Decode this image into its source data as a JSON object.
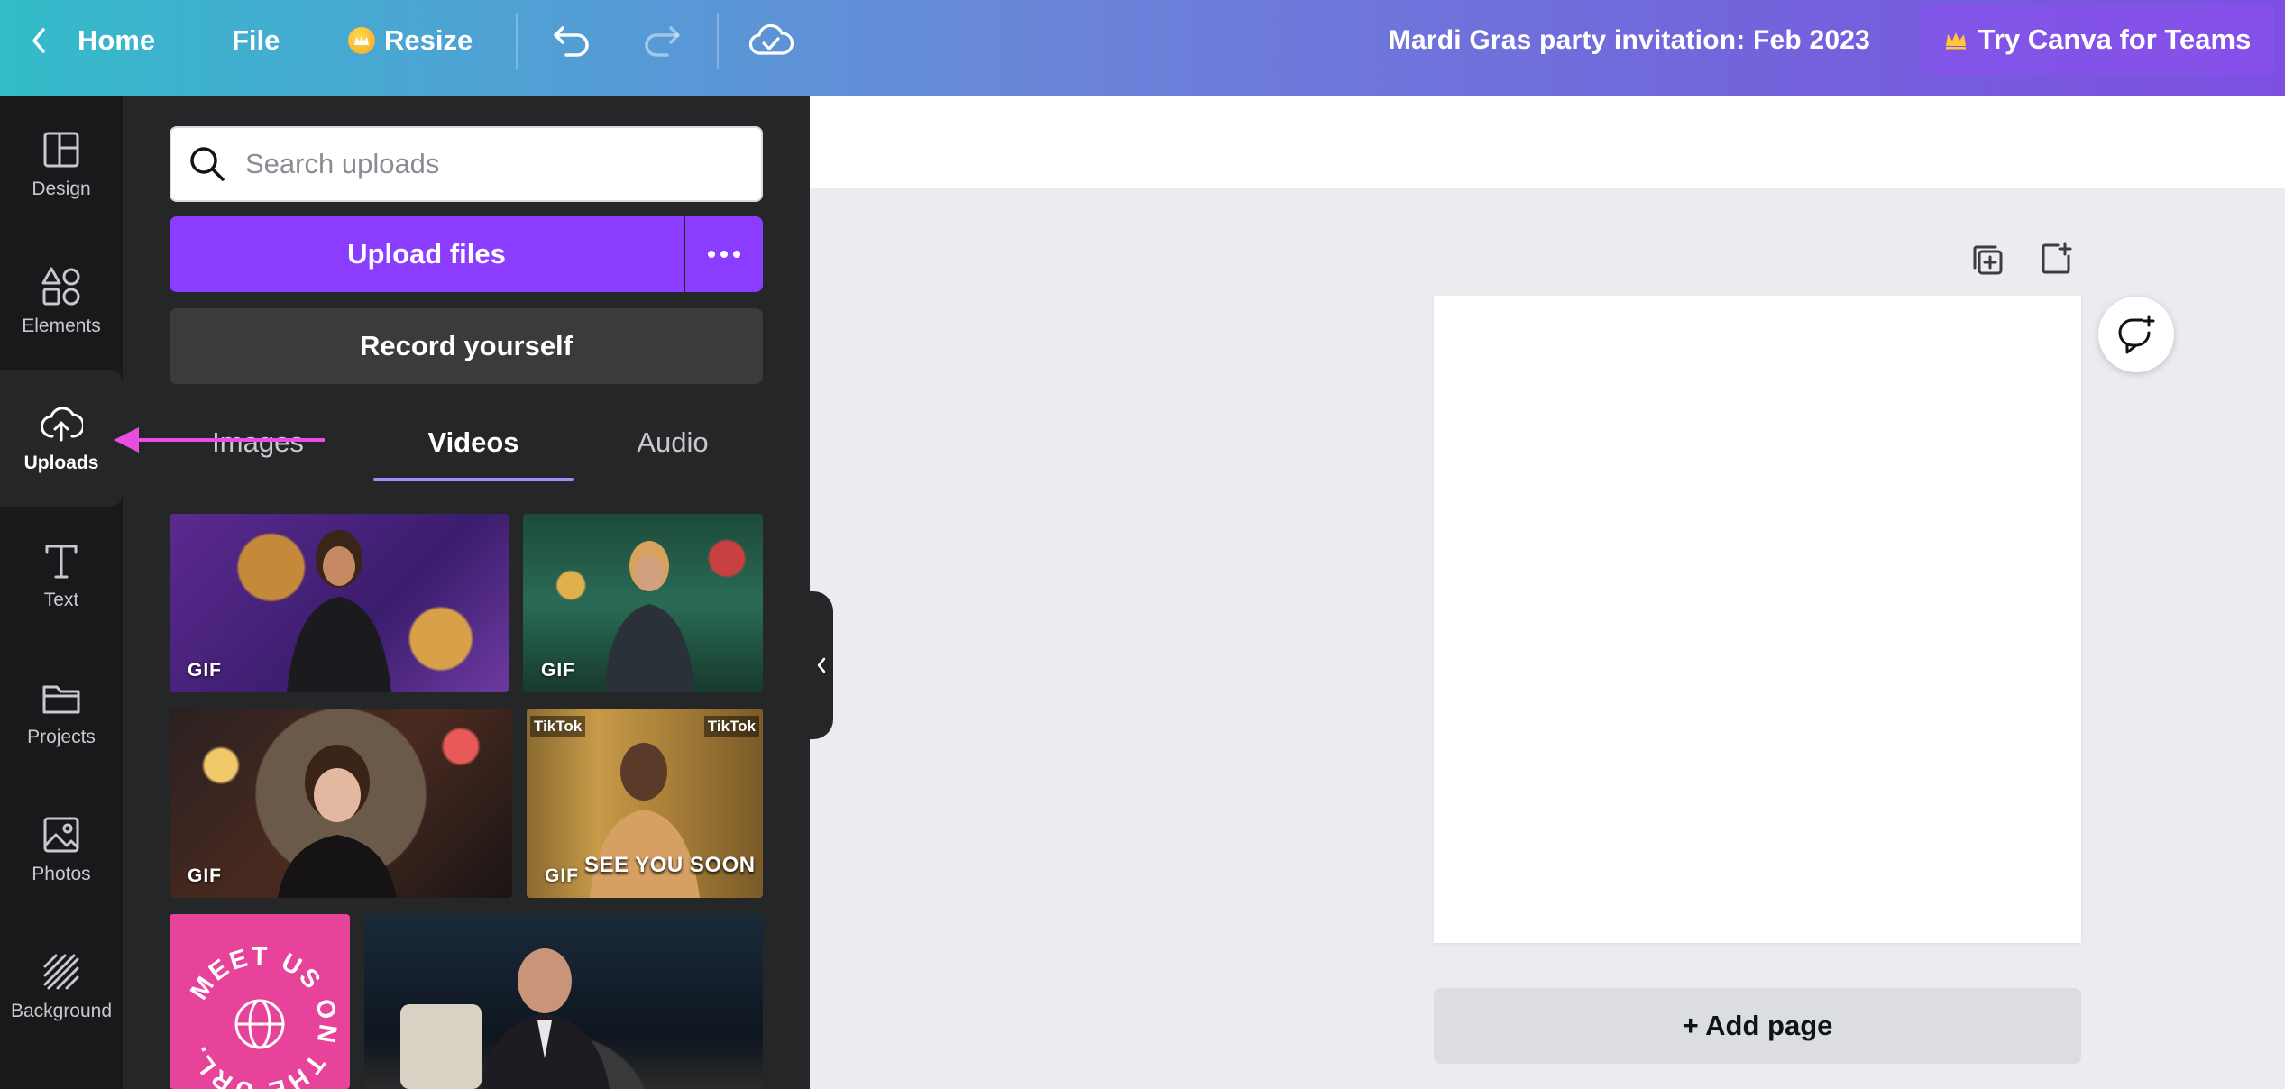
{
  "topbar": {
    "home_label": "Home",
    "file_label": "File",
    "resize_label": "Resize",
    "doc_title": "Mardi Gras party invitation: Feb 2023",
    "teams_label": "Try Canva for Teams"
  },
  "rail": {
    "items": [
      {
        "label": "Design",
        "icon": "layout-icon"
      },
      {
        "label": "Elements",
        "icon": "shapes-icon"
      },
      {
        "label": "Uploads",
        "icon": "cloud-upload-icon"
      },
      {
        "label": "Text",
        "icon": "text-icon"
      },
      {
        "label": "Projects",
        "icon": "folder-icon"
      },
      {
        "label": "Photos",
        "icon": "image-icon"
      },
      {
        "label": "Background",
        "icon": "stripes-icon"
      }
    ]
  },
  "panel": {
    "search_placeholder": "Search uploads",
    "upload_label": "Upload files",
    "record_label": "Record yourself",
    "tabs": [
      {
        "label": "Images",
        "active": false
      },
      {
        "label": "Videos",
        "active": true
      },
      {
        "label": "Audio",
        "active": false
      }
    ],
    "thumbs": [
      {
        "tag": "GIF"
      },
      {
        "tag": "GIF"
      },
      {
        "tag": "GIF"
      },
      {
        "tag": "GIF",
        "caption": "SEE YOU SOON",
        "watermark": "TikTok"
      }
    ],
    "sticker_text": "MEET US ON THE URL."
  },
  "canvas": {
    "add_page_label": "+ Add page"
  },
  "colors": {
    "accent": "#8b3dff",
    "annotation_arrow": "#e84fe0",
    "tab_underline": "#a78bfa"
  }
}
